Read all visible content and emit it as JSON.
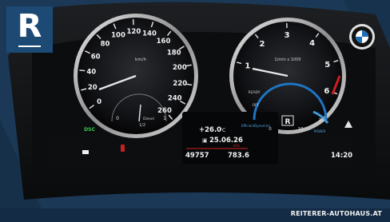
{
  "brand": {
    "letter": "R",
    "site": "REITERER-AUTOHAUS.AT"
  },
  "speedometer": {
    "ticks": [
      "0",
      "20",
      "40",
      "60",
      "80",
      "100",
      "120",
      "140",
      "160",
      "180",
      "200",
      "220",
      "240",
      "260"
    ],
    "unit": "km/h"
  },
  "tachometer": {
    "ticks": [
      "1",
      "2",
      "3",
      "4",
      "5",
      "6"
    ],
    "unit": "1/min x 1000",
    "ready_label": "READY",
    "off_label": "OFF"
  },
  "fuel": {
    "label": "Diesel",
    "half": "1/2",
    "empty": "0",
    "full": "1"
  },
  "eco": {
    "label": "EfficientDynamics",
    "power_label": "POWER",
    "start": "0",
    "mid": "10",
    "end": "20"
  },
  "center": {
    "temperature": "+26.0",
    "temp_unit": "°C",
    "date": "25.06.26",
    "trip_unit": "km",
    "odometer": "49757",
    "trip": "783.6",
    "gear": "R",
    "time": "14:20"
  },
  "indicators": {
    "dsc": "DSC"
  }
}
